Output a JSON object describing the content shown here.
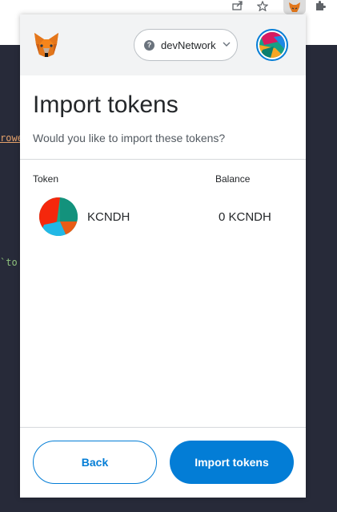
{
  "browser": {
    "icons": [
      "share-icon",
      "star-icon",
      "metamask-extension-icon",
      "puzzle-icon"
    ]
  },
  "editor": {
    "fragment_1": "rowe",
    "fragment_2": "`to"
  },
  "header": {
    "logo_icon": "metamask-fox-icon",
    "network_label": "devNetwork",
    "network_help_glyph": "?",
    "network_chevron_icon": "chevron-down-icon",
    "avatar_icon": "account-jazzicon"
  },
  "main": {
    "title": "Import tokens",
    "subtitle": "Would you like to import these tokens?",
    "columns": {
      "token": "Token",
      "balance": "Balance"
    },
    "tokens": [
      {
        "symbol": "KCNDH",
        "balance": "0 KCNDH",
        "icon": "token-jazzicon"
      }
    ]
  },
  "footer": {
    "back_label": "Back",
    "import_label": "Import tokens"
  },
  "colors": {
    "primary": "#037dd6",
    "header_bg": "#f2f3f4",
    "editor_bg": "#272a39",
    "text": "#24272a"
  }
}
